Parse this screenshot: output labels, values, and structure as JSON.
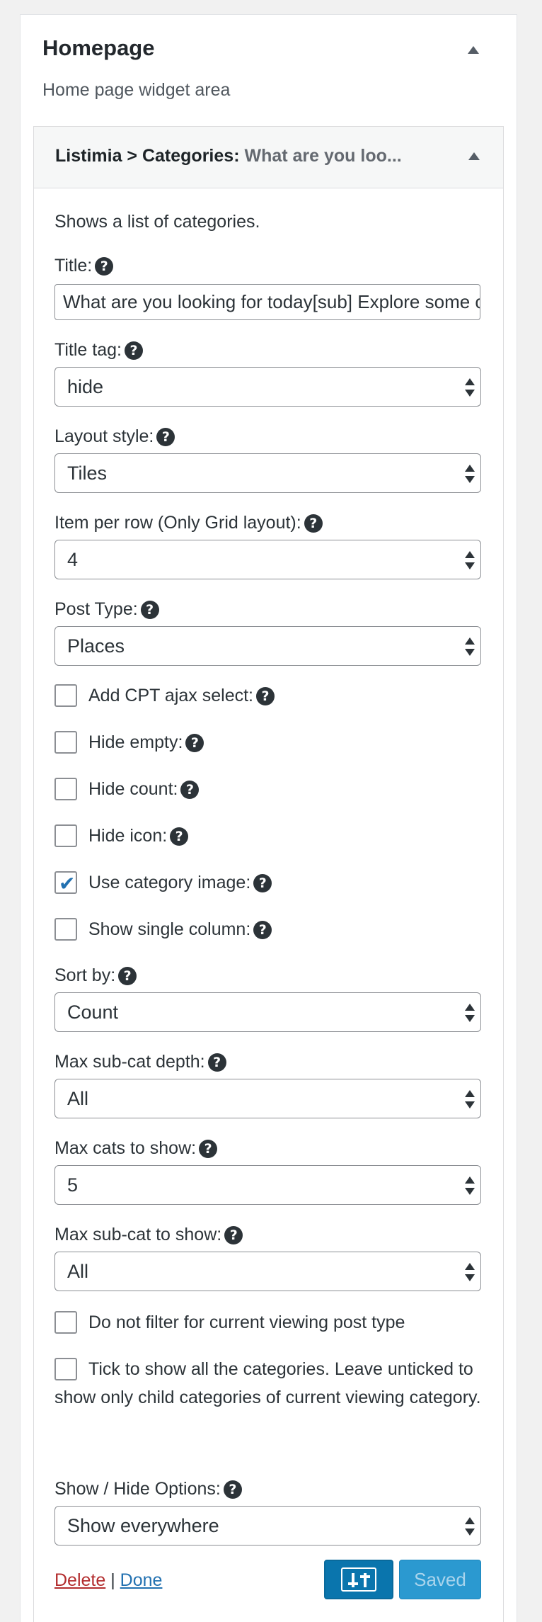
{
  "sidebar": {
    "title": "Homepage",
    "description": "Home page widget area"
  },
  "widget": {
    "title_prefix": "Listimia > Categories",
    "title_sep": ": ",
    "title_suffix": "What are you loo...",
    "description": "Shows a list of categories.",
    "fields": {
      "title": {
        "label": "Title:",
        "value": "What are you looking for today[sub] Explore some of the best"
      },
      "title_tag": {
        "label": "Title tag:",
        "value": "hide"
      },
      "layout_style": {
        "label": "Layout style:",
        "value": "Tiles"
      },
      "per_row": {
        "label": "Item per row (Only Grid layout):",
        "value": "4"
      },
      "post_type": {
        "label": "Post Type:",
        "value": "Places"
      },
      "sort_by": {
        "label": "Sort by:",
        "value": "Count"
      },
      "max_subcat_depth": {
        "label": "Max sub-cat depth:",
        "value": "All"
      },
      "max_cats": {
        "label": "Max cats to show:",
        "value": "5"
      },
      "max_subcat_show": {
        "label": "Max sub-cat to show:",
        "value": "All"
      },
      "show_hide": {
        "label": "Show / Hide Options:",
        "value": "Show everywhere"
      }
    },
    "checkboxes": {
      "cpt_ajax": {
        "label": "Add CPT ajax select:",
        "checked": false
      },
      "hide_empty": {
        "label": "Hide empty:",
        "checked": false
      },
      "hide_count": {
        "label": "Hide count:",
        "checked": false
      },
      "hide_icon": {
        "label": "Hide icon:",
        "checked": false
      },
      "use_cat_image": {
        "label": "Use category image:",
        "checked": true
      },
      "single_column": {
        "label": "Show single column:",
        "checked": false
      },
      "no_filter": {
        "label": "Do not filter for current viewing post type",
        "checked": false
      },
      "show_all": {
        "label": "Tick to show all the categories. Leave unticked to show only child categories of current viewing category.",
        "checked": false
      }
    },
    "help_glyph": "?",
    "check_glyph": "✔",
    "footer": {
      "delete_label": "Delete",
      "separator": "|",
      "done_label": "Done",
      "saved_label": "Saved"
    }
  },
  "icons": {
    "help": "question-circle-icon",
    "collapse": "triangle-up-icon",
    "select": "updown-arrows-icon",
    "settings": "sliders-icon"
  },
  "colors": {
    "accent": "#2271b1",
    "delete": "#b32d2e",
    "primary_button": "#0a75ad",
    "saved_button": "#2b99d0"
  }
}
